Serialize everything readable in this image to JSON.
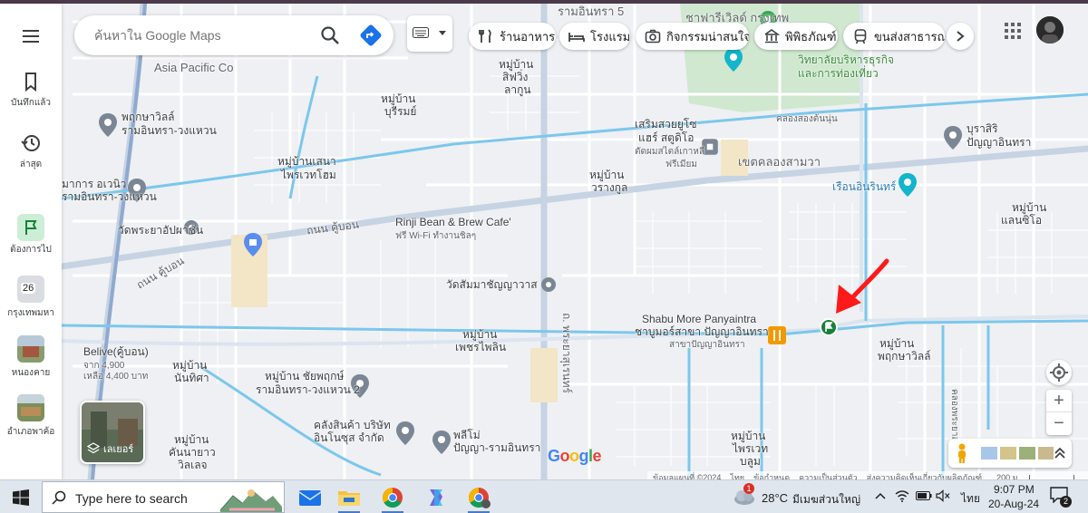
{
  "rail": {
    "menu_icon": "hamburger-menu-icon",
    "items": [
      {
        "label": "บันทึกแล้ว",
        "icon": "bookmark-icon"
      },
      {
        "label": "ล่าสุด",
        "icon": "history-icon"
      },
      {
        "label": "ต้องการไป",
        "icon": "flag-icon"
      },
      {
        "label": "กรุงเทพมหา",
        "badge": "26",
        "icon": "recent-place-thumbnail"
      },
      {
        "label": "หนองคาย",
        "icon": "recent-place-thumbnail"
      },
      {
        "label": "อำเภอพาค้อ",
        "icon": "recent-place-thumbnail"
      }
    ]
  },
  "search": {
    "placeholder": "ค้นหาใน Google Maps",
    "search_icon": "search-icon",
    "directions_icon": "directions-icon"
  },
  "chips": [
    {
      "label": "ร้านอาหาร",
      "icon": "restaurant-icon"
    },
    {
      "label": "โรงแรม",
      "icon": "hotel-icon"
    },
    {
      "label": "กิจกรรมน่าสนใจ",
      "icon": "camera-icon"
    },
    {
      "label": "พิพิธภัณฑ์",
      "icon": "museum-icon"
    },
    {
      "label": "ขนส่งสาธารณะ",
      "icon": "transit-icon"
    }
  ],
  "map_labels": {
    "l1": "รามอินทรา 5",
    "l2": "Asia Pacific Co",
    "l3": "ชาฟารีเวิลด์ กรุงเทพ",
    "l4": "วิทยาลัยบริหารธุรกิจ",
    "l5": "และการท่องเที่ยว",
    "l6": "หมู่บ้าน",
    "l7": "สิฟวิ่ง",
    "l8": "ลากูน",
    "l9": "พฤกษาวิลล์",
    "l10": "รามอินทรา-วงแหวน",
    "l11": "หมู่บ้าน",
    "l12": "บุรีรมย์",
    "l13": "เสริมสวยยูโซ",
    "l14": "แฮร์ สตูดิโอ",
    "l15": "ตัดผมสไตล์เกาหลี",
    "l16": "ฟรีเมียม",
    "l17": "คลองสองต้นนุ่น",
    "l18": "บุราสิริ",
    "l19": "ปัญญาอินทรา",
    "l20": "หมู่บ้านเสนา",
    "l21": "ไพรเวทโฮม",
    "l22": "หมู่บ้าน",
    "l23": "วรางกูล",
    "l24": "เขตคลองสามวา",
    "l25": "เรือนอินรินทร์",
    "l26": "มาการ อเวนิว",
    "l27": "รามอินทรา-วงแหวน",
    "l28": "หมู่บ้าน",
    "l29": "แลนซิโอ",
    "l30": "ถนน คู้บอน",
    "l31": "Rinji Bean & Brew Cafe'",
    "l32": "ฟรี Wi-Fi ทำงานชิลๆ",
    "l33": "วัดพระยาอัปผาชัน",
    "l34": "ถนน คู้บอน",
    "l35": "วัดสัมมาชัญญาวาส",
    "l36": "Shabu More Panyaintra",
    "l37": "ชาบูมอร์สาขา ปัญญาอินทรา",
    "l38": "สาขาปัญญาอินทรา",
    "l39": "หมู่บ้าน",
    "l40": "เพชรไพลิน",
    "l41": "ถ. พระยาสุเรนทร์",
    "l42": "หมู่บ้าน",
    "l43": "พฤกษาวิลล์",
    "l44": "Belive(คู้บอน)",
    "l45": "จาก 4,900",
    "l46": "เหลือ 4,400 บาท",
    "l47": "หมู่บ้าน",
    "l48": "นันทิศา",
    "l49": "หมู่บ้าน ชัยพฤกษ์",
    "l50": "รามอินทรา-วงแหวน 2",
    "l51": "คลังสินค้า บริษัท",
    "l52": "อินโนซุส จำกัด",
    "l53": "พลีโม่",
    "l54": "ปัญญา-รามอินทรา",
    "l55": "หมู่บ้าน",
    "l56": "ไพรเวท",
    "l57": "บลูม",
    "l58": "หมู่บ้าน",
    "l59": "คันนายาว",
    "l60": "วิลเลจ",
    "l61": "คลองพระยาสุเรนทร์"
  },
  "layers": {
    "label": "เลเยอร์",
    "icon": "layers-icon"
  },
  "controls": {
    "location_icon": "my-location-icon",
    "zoom_in": "+",
    "zoom_out": "−",
    "pegman_icon": "street-view-pegman-icon",
    "expand_icon": "chevron-up-double-icon"
  },
  "google_logo": "Google",
  "attribution": {
    "data": "ข้อมูลแผนที่ ©2024",
    "country": "ไทย",
    "terms": "ข้อกำหนด",
    "privacy": "ความเป็นส่วนตัว",
    "feedback": "ส่งความคิดเห็นเกี่ยวกับผลิตภัณฑ์",
    "scale": "200 ม."
  },
  "taskbar": {
    "start_icon": "windows-start-icon",
    "search_placeholder": "Type here to search",
    "apps": [
      "mail-app-icon",
      "file-explorer-icon",
      "chrome-icon",
      "copilot-icon",
      "chrome-profile-icon"
    ],
    "weather": "28°C",
    "weather_desc": "มีเมฆส่วนใหญ่",
    "weather_badge": "1",
    "lang": "ไทย",
    "time": "9:07 PM",
    "date": "20-Aug-24",
    "notif_count": "2"
  },
  "colors": {
    "water": "#7cc7ec",
    "road_major": "#c6d3e3",
    "park": "#cfe8cf",
    "accent": "#1a73e8",
    "pin_green": "#188038",
    "arrow_red": "#ff1a1a"
  }
}
